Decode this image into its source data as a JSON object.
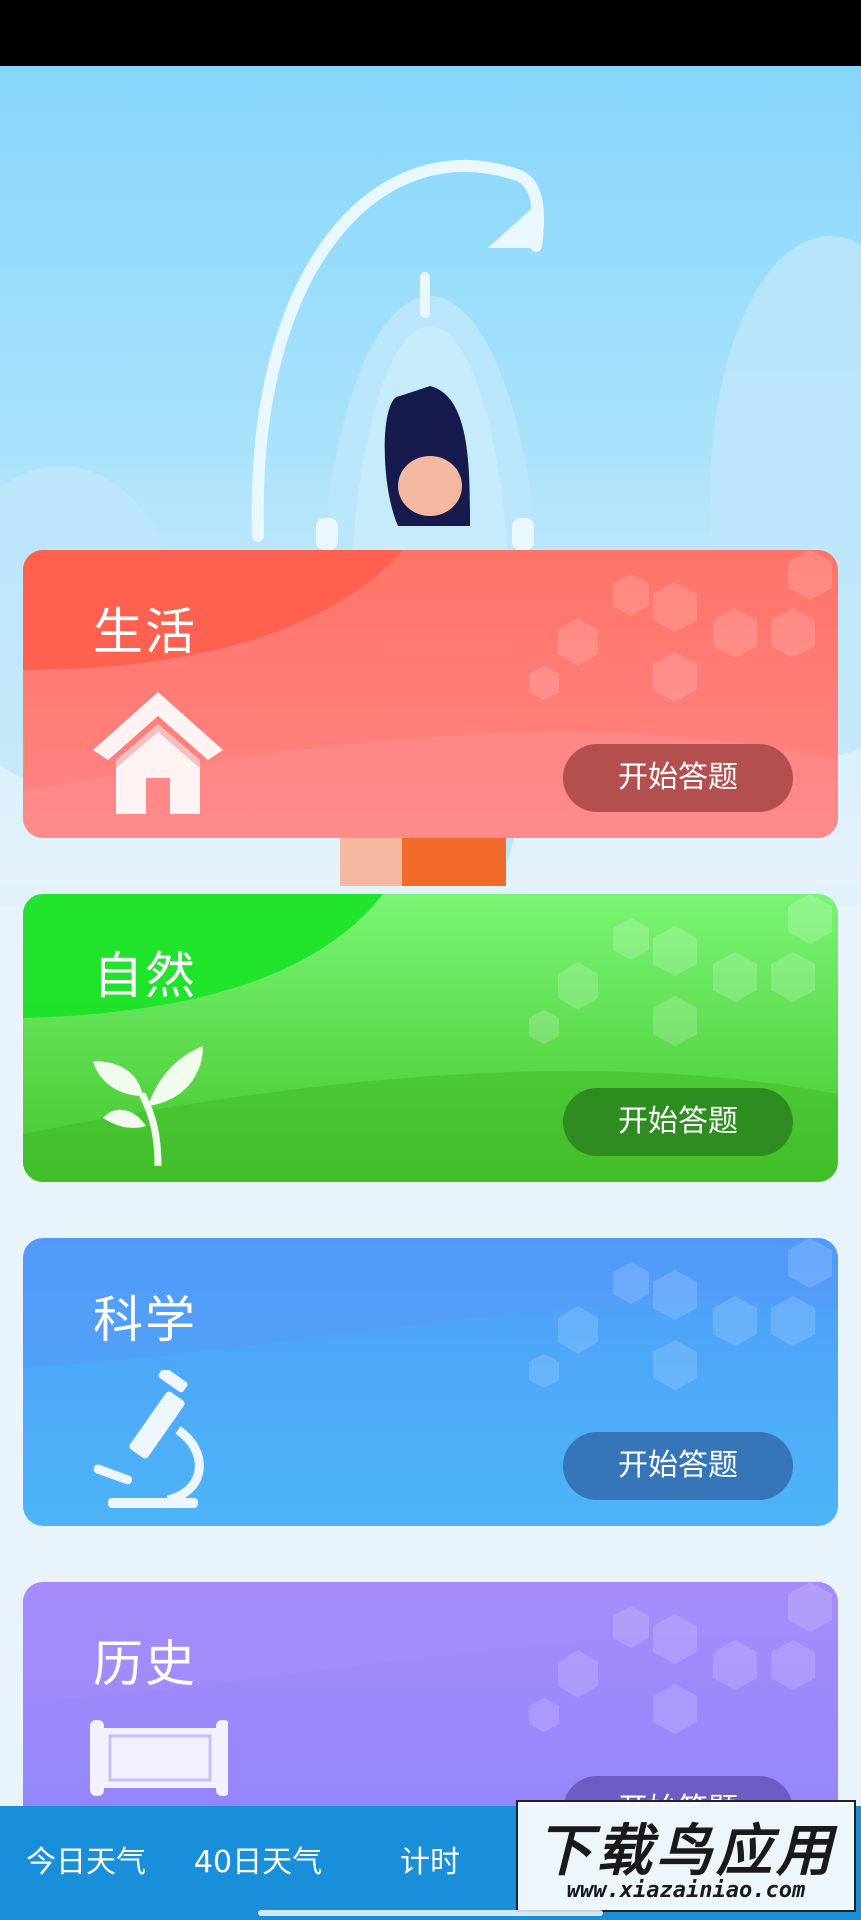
{
  "categories": [
    {
      "title": "生活",
      "button": "开始答题",
      "icon": "house-icon"
    },
    {
      "title": "自然",
      "button": "开始答题",
      "icon": "leaf-icon"
    },
    {
      "title": "科学",
      "button": "开始答题",
      "icon": "microscope-icon"
    },
    {
      "title": "历史",
      "button": "开始答题",
      "icon": "scroll-icon"
    }
  ],
  "tabs": [
    "今日天气",
    "40日天气",
    "计时",
    "",
    ""
  ],
  "watermark": {
    "main": "下载鸟应用",
    "url": "www.xiazainiao.com"
  },
  "colors": {
    "life": "#ff7468",
    "nature": "#5cd93f",
    "science": "#4da8f8",
    "history": "#9a88fb",
    "tab_bar": "#1a8fd9"
  }
}
